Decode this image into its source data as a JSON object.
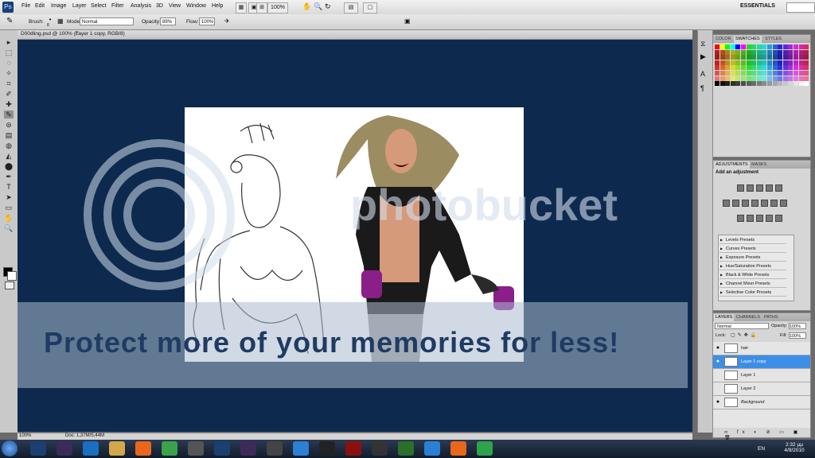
{
  "menu": {
    "logo": "Ps",
    "items": [
      "File",
      "Edit",
      "Image",
      "Layer",
      "Select",
      "Filter",
      "Analysis",
      "3D",
      "View",
      "Window",
      "Help"
    ],
    "zoom": "100%",
    "workspace": "ESSENTIALS"
  },
  "options": {
    "brush_label": "Brush:",
    "brush_size": "8",
    "mode_label": "Mode:",
    "mode_value": "Normal",
    "opacity_label": "Opacity:",
    "opacity_value": "89%",
    "flow_label": "Flow:",
    "flow_value": "100%"
  },
  "document": {
    "tab_title": "D00dling.psd @ 100% (Layer 1 copy, RGB/8)",
    "zoom": "100%",
    "doc_size": "Doc: 1,37M/5,44M"
  },
  "watermark": {
    "brand": "photobucket",
    "tagline": "Protect more of your memories for less!"
  },
  "swatches_panel": {
    "tabs": [
      "COLOR",
      "SWATCHES",
      "STYLES"
    ],
    "active": "SWATCHES"
  },
  "adjustments_panel": {
    "tabs": [
      "ADJUSTMENTS",
      "MASKS"
    ],
    "heading": "Add an adjustment",
    "presets": [
      "Levels Presets",
      "Curves Presets",
      "Exposure Presets",
      "Hue/Saturation Presets",
      "Black & White Presets",
      "Channel Mixer Presets",
      "Selective Color Presets"
    ]
  },
  "layers_panel": {
    "tabs": [
      "LAYERS",
      "CHANNELS",
      "PATHS"
    ],
    "blend_mode": "Normal",
    "opacity_label": "Opacity:",
    "opacity_value": "100%",
    "lock_label": "Lock:",
    "fill_label": "Fill:",
    "fill_value": "100%",
    "layers": [
      {
        "name": "hair",
        "visible": true,
        "selected": false
      },
      {
        "name": "Layer 1 copy",
        "visible": true,
        "selected": true
      },
      {
        "name": "Layer 1",
        "visible": false,
        "selected": false
      },
      {
        "name": "Layer 2",
        "visible": false,
        "selected": false
      },
      {
        "name": "Background",
        "visible": true,
        "selected": false
      }
    ]
  },
  "taskbar": {
    "language": "EN",
    "time": "2:32 μμ",
    "date": "4/9/2010",
    "apps": [
      "ps-icon",
      "ae-icon",
      "ie-icon",
      "folder-icon",
      "firefox-icon",
      "chrome-icon",
      "brush-icon",
      "ps-icon",
      "ae-icon",
      "gamepad-icon",
      "chat-icon",
      "dtk-icon",
      "game-icon",
      "media-icon",
      "game2-icon",
      "chat2-icon",
      "firefox-icon",
      "utorrent-icon"
    ]
  },
  "colors": {
    "canvas_bg": "#0d2a4e",
    "selection": "#3d8ee6",
    "panel_bg": "#d6d6d6"
  }
}
